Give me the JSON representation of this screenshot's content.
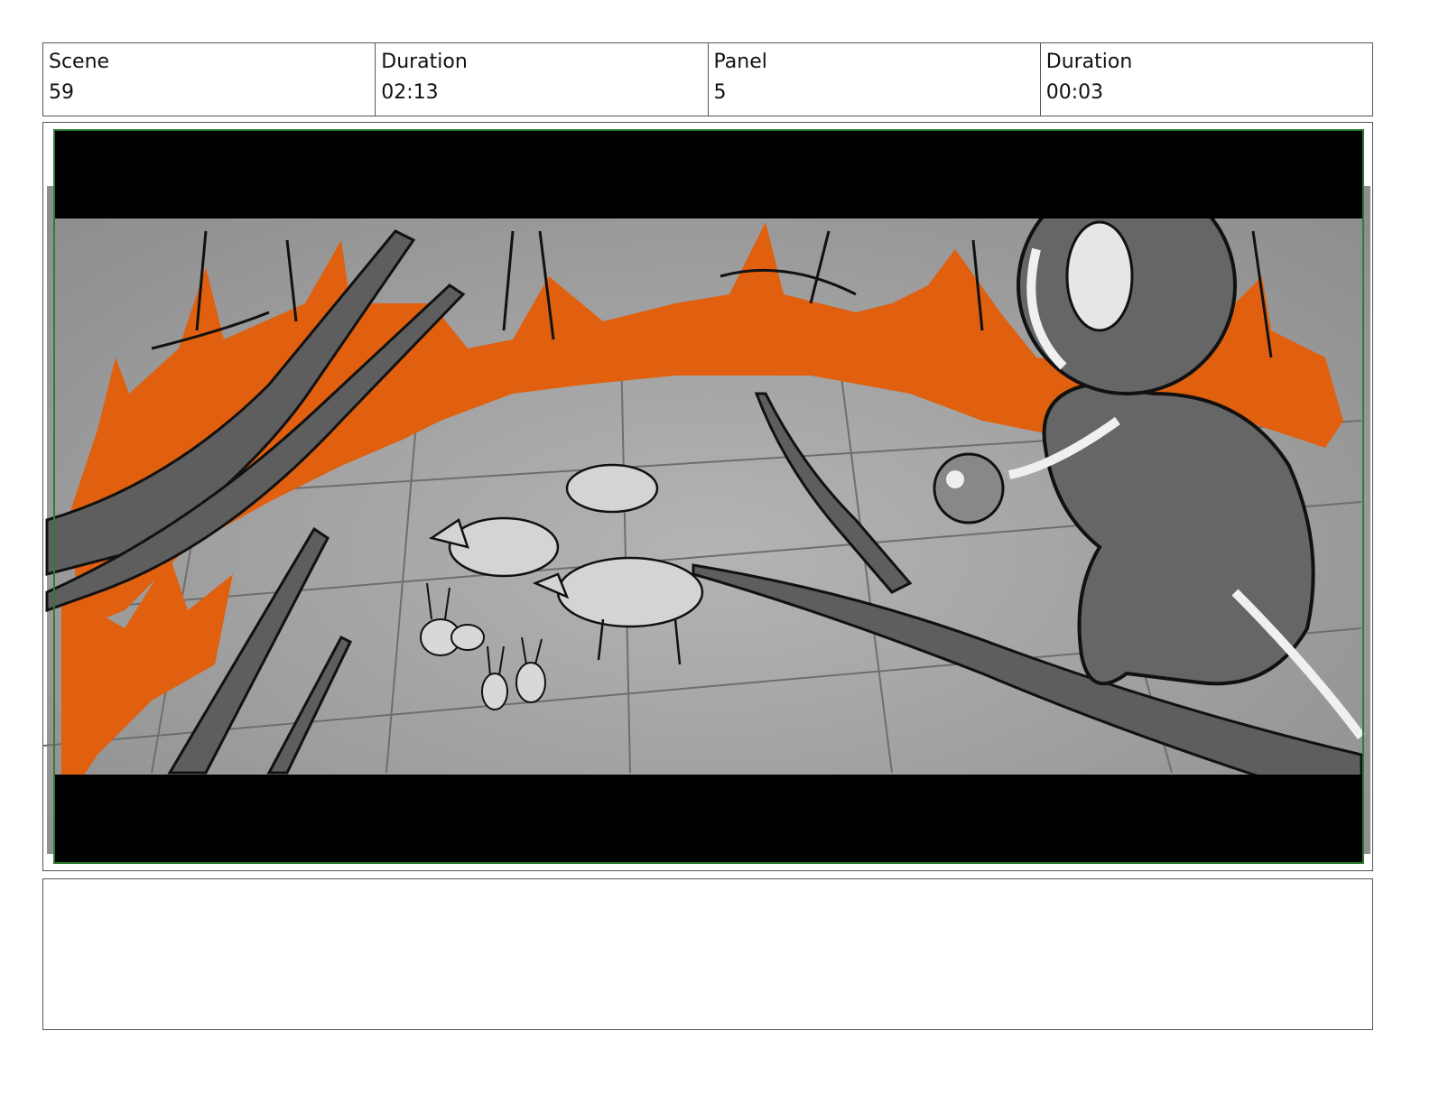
{
  "header": {
    "cells": [
      {
        "label": "Scene",
        "value": "59"
      },
      {
        "label": "Duration",
        "value": "02:13"
      },
      {
        "label": "Panel",
        "value": "5"
      },
      {
        "label": "Duration",
        "value": "00:03"
      }
    ]
  },
  "notes": {
    "text": ""
  },
  "colors": {
    "fire": "#e0600f",
    "ground": "#9a9a9a",
    "branch": "#5e5e5e",
    "safe_frame": "#2e7d32",
    "letterbox": "#000000"
  }
}
